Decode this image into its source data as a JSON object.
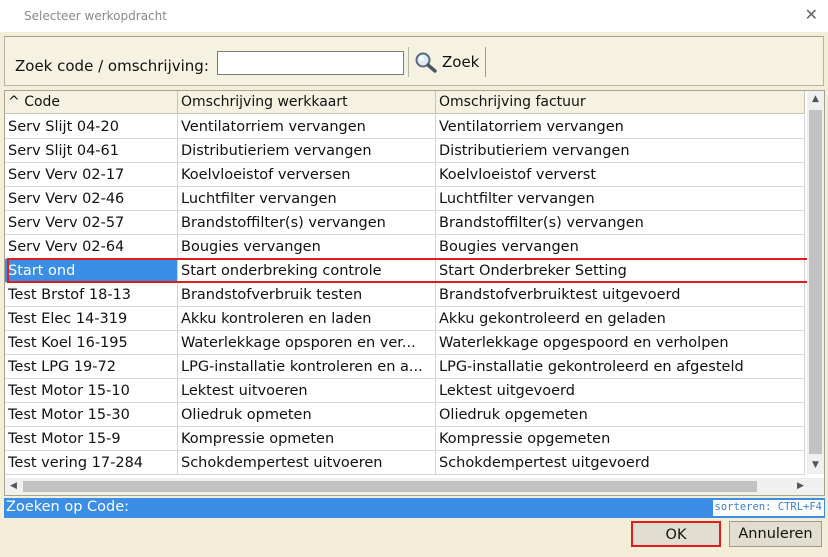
{
  "window": {
    "title": "Selecteer werkopdracht",
    "close_glyph": "✕"
  },
  "search": {
    "label": "Zoek code / omschrijving:",
    "value": "",
    "placeholder": "",
    "button_label": "Zoek",
    "button_icon": "magnifier-icon"
  },
  "table": {
    "sort_indicator": "^",
    "columns": [
      "Code",
      "Omschrijving werkkaart",
      "Omschrijving factuur"
    ],
    "rows": [
      [
        "Serv Slijt 04-20",
        "Ventilatorriem vervangen",
        "Ventilatorriem vervangen"
      ],
      [
        "Serv Slijt 04-61",
        "Distributieriem vervangen",
        "Distributieriem vervangen"
      ],
      [
        "Serv Verv 02-17",
        "Koelvloeistof verversen",
        "Koelvloeistof ververst"
      ],
      [
        "Serv Verv 02-46",
        "Luchtfilter vervangen",
        "Luchtfilter vervangen"
      ],
      [
        "Serv Verv 02-57",
        "Brandstoffilter(s) vervangen",
        "Brandstoffilter(s) vervangen"
      ],
      [
        "Serv Verv 02-64",
        "Bougies vervangen",
        "Bougies vervangen"
      ],
      [
        "Start ond",
        "Start onderbreking controle",
        "Start Onderbreker Setting"
      ],
      [
        "Test Brstof 18-13",
        "Brandstofverbruik testen",
        "Brandstofverbruiktest uitgevoerd"
      ],
      [
        "Test Elec 14-319",
        "Akku kontroleren en laden",
        "Akku gekontroleerd en geladen"
      ],
      [
        "Test Koel 16-195",
        "Waterlekkage opsporen en ver...",
        "Waterlekkage opgespoord en verholpen"
      ],
      [
        "Test LPG 19-72",
        "LPG-installatie kontroleren en a...",
        "LPG-installatie gekontroleerd en afgesteld"
      ],
      [
        "Test Motor 15-10",
        "Lektest uitvoeren",
        "Lektest uitgevoerd"
      ],
      [
        "Test Motor 15-30",
        "Oliedruk opmeten",
        "Oliedruk opgemeten"
      ],
      [
        "Test Motor 15-9",
        "Kompressie opmeten",
        "Kompressie opgemeten"
      ],
      [
        "Test vering 17-284",
        "Schokdempertest uitvoeren",
        "Schokdempertest uitgevoerd"
      ]
    ],
    "selected_row": 6,
    "highlight_color": "#e01c1c",
    "selection_color": "#3a8ee6"
  },
  "status": {
    "text": "Zoeken op Code:",
    "sort_hint": "sorteren: CTRL+F4"
  },
  "buttons": {
    "ok": "OK",
    "cancel": "Annuleren"
  }
}
